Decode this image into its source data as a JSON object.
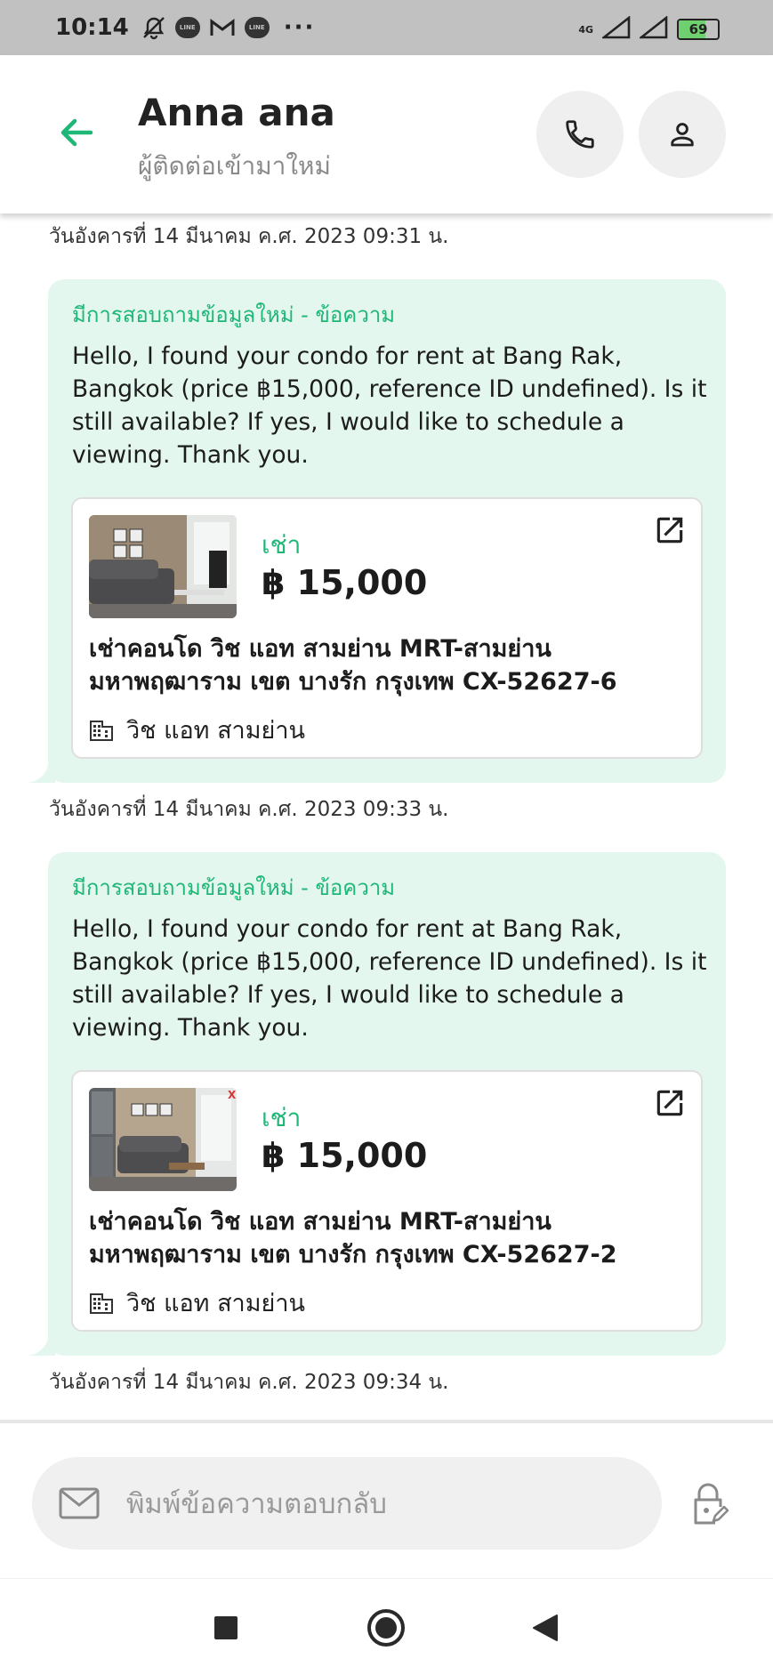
{
  "status_bar": {
    "time": "10:14",
    "network": "4G",
    "battery": "69",
    "battery_level": 0.69,
    "icons": [
      "do-not-disturb-icon",
      "line-icon",
      "gmail-icon",
      "line-icon",
      "more-icon"
    ],
    "more": "···"
  },
  "header": {
    "contact_name": "Anna ana",
    "subtitle": "ผู้ติดต่อเข้ามาใหม่"
  },
  "messages": [
    {
      "timestamp_before": "วันอังคารที่ 14 มีนาคม ค.ศ. 2023 09:31 น.",
      "title": "มีการสอบถามข้อมูลใหม่ - ข้อความ",
      "body": "Hello, I found your condo for rent at Bang Rak, Bangkok (price ฿15,000, reference ID undefined). Is it still available? If yes, I would like to schedule a viewing. Thank you.",
      "listing": {
        "type": "เช่า",
        "price": "฿ 15,000",
        "title_line1": "เช่าคอนโด  วิช แอท สามย่าน MRT-สามย่าน",
        "title_line2": "มหาพฤฒาราม เขต บางรัก กรุงเทพ CX-52627-6",
        "project": "วิช แอท สามย่าน"
      }
    },
    {
      "timestamp_before": "วันอังคารที่ 14 มีนาคม ค.ศ. 2023 09:33 น.",
      "title": "มีการสอบถามข้อมูลใหม่ - ข้อความ",
      "body": "Hello, I found your condo for rent at Bang Rak, Bangkok (price ฿15,000, reference ID undefined). Is it still available? If yes, I would like to schedule a viewing. Thank you.",
      "listing": {
        "type": "เช่า",
        "price": "฿ 15,000",
        "title_line1": "เช่าคอนโด  วิช แอท สามย่าน MRT-สามย่าน",
        "title_line2": "มหาพฤฒาราม เขต บางรัก กรุงเทพ CX-52627-2",
        "project": "วิช แอท สามย่าน"
      }
    }
  ],
  "last_timestamp": "วันอังคารที่ 14 มีนาคม ค.ศ. 2023 09:34 น.",
  "composer": {
    "placeholder": "พิมพ์ข้อความตอบกลับ"
  },
  "colors": {
    "accent": "#1fb777",
    "bubble_bg": "#e4f7ef",
    "status_bar_bg": "#c1c1c1"
  }
}
